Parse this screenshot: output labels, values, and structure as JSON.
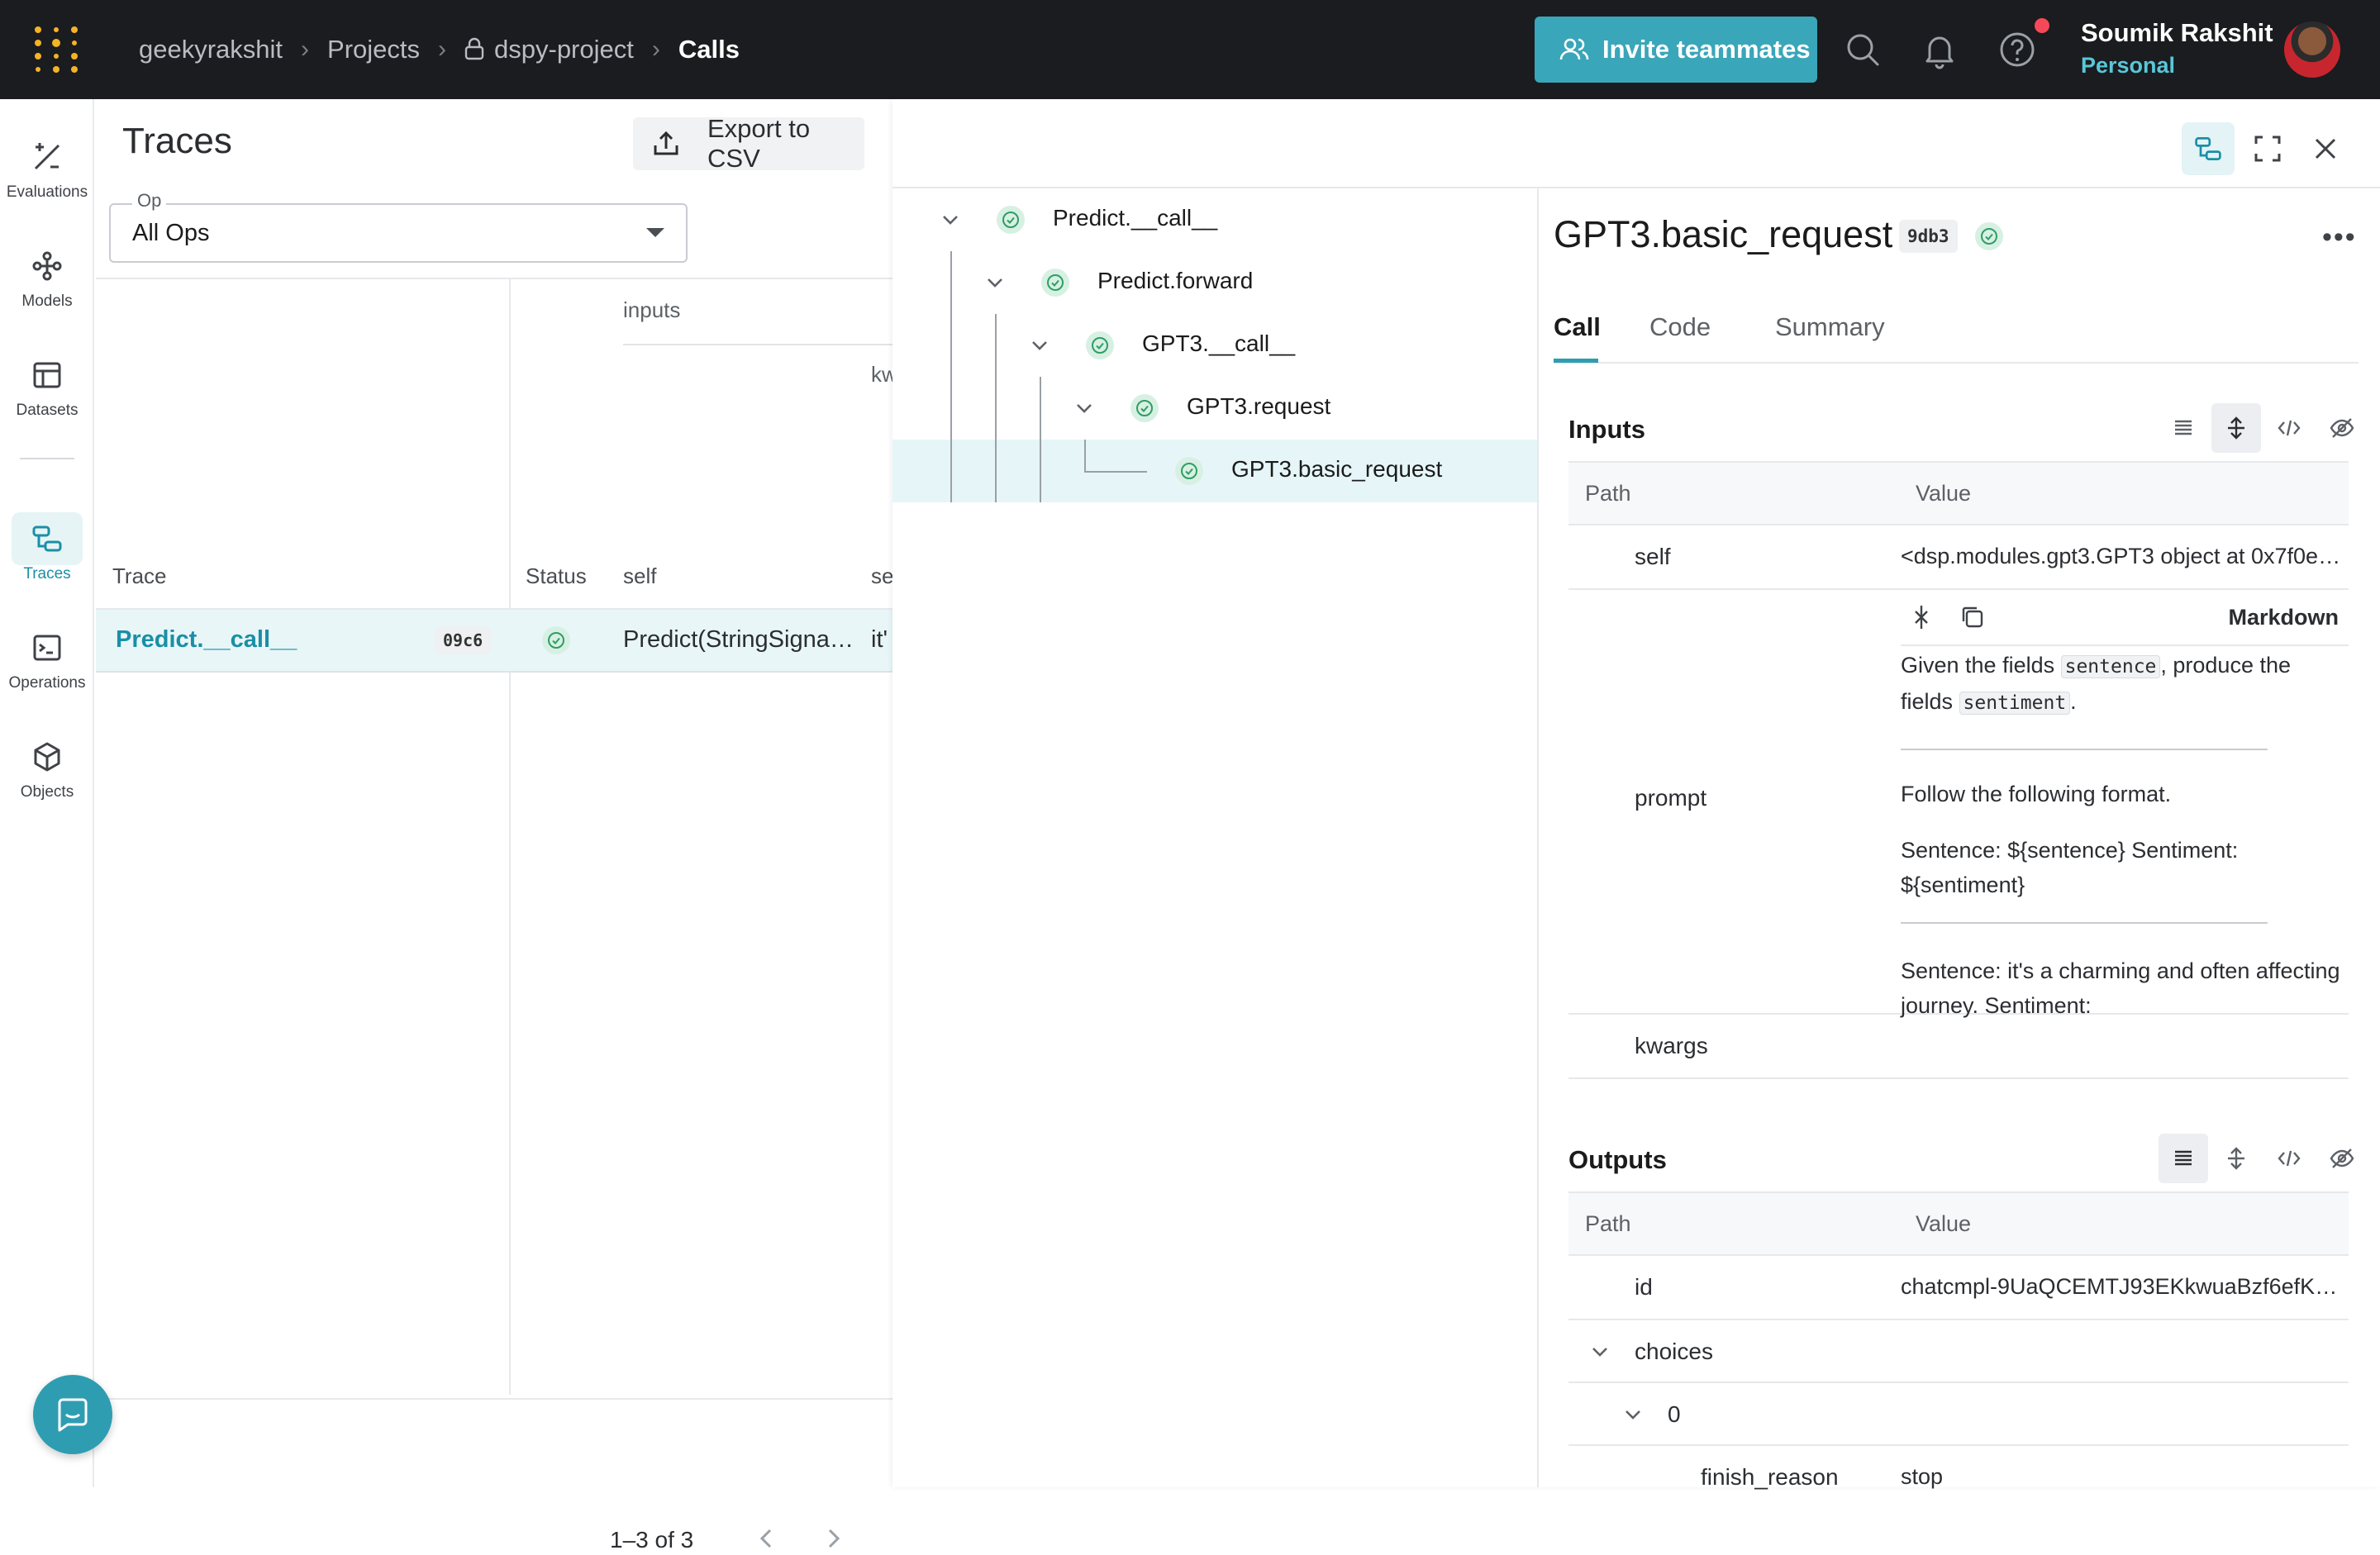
{
  "breadcrumb": {
    "entity": "geekyrakshit",
    "projects": "Projects",
    "project": "dspy-project",
    "page": "Calls"
  },
  "header": {
    "invite_label": "Invite teammates",
    "user_name": "Soumik Rakshit",
    "user_account": "Personal"
  },
  "sidebar": {
    "items": [
      {
        "label": "Evaluations",
        "icon": "evaluations-icon"
      },
      {
        "label": "Models",
        "icon": "models-icon"
      },
      {
        "label": "Datasets",
        "icon": "datasets-icon"
      },
      {
        "label": "Traces",
        "icon": "traces-icon"
      },
      {
        "label": "Operations",
        "icon": "operations-icon"
      },
      {
        "label": "Objects",
        "icon": "objects-icon"
      }
    ]
  },
  "traces": {
    "title": "Traces",
    "export_label": "Export to CSV",
    "op_label": "Op",
    "op_value": "All Ops",
    "group_inputs": "inputs",
    "group_kw": "kw",
    "columns": {
      "trace": "Trace",
      "status": "Status",
      "self": "self",
      "se": "se"
    },
    "rows": [
      {
        "name": "Predict.__call__",
        "id": "09c6",
        "self": "Predict(StringSigna…",
        "se": "it'"
      }
    ],
    "pagination": "1–3 of 3"
  },
  "tree": {
    "nodes": [
      {
        "label": "Predict.__call__"
      },
      {
        "label": "Predict.forward"
      },
      {
        "label": "GPT3.__call__"
      },
      {
        "label": "GPT3.request"
      },
      {
        "label": "GPT3.basic_request"
      }
    ]
  },
  "detail": {
    "title": "GPT3.basic_request",
    "id": "9db3",
    "more": "•••",
    "tabs": [
      "Call",
      "Code",
      "Summary"
    ],
    "inputs": {
      "title": "Inputs",
      "path_header": "Path",
      "value_header": "Value",
      "self_key": "self",
      "self_value": "<dsp.modules.gpt3.GPT3 object at 0x7f0e2…",
      "prompt_key": "prompt",
      "markdown_label": "Markdown",
      "prompt_line1_a": "Given the fields ",
      "prompt_code1": "sentence",
      "prompt_line1_b": ", produce the",
      "prompt_line2_a": "fields ",
      "prompt_code2": "sentiment",
      "prompt_line2_b": ".",
      "prompt_p2": "Follow the following format.",
      "prompt_p3": "Sentence: ${sentence} Sentiment: ${sentiment}",
      "prompt_p4": "Sentence: it's a charming and often affecting journey. Sentiment:",
      "kwargs_key": "kwargs"
    },
    "outputs": {
      "title": "Outputs",
      "path_header": "Path",
      "value_header": "Value",
      "id_key": "id",
      "id_value": "chatcmpl-9UaQCEMTJ93EKkwuaBzf6efKm…",
      "choices_key": "choices",
      "index_key": "0",
      "finish_key": "finish_reason",
      "finish_value": "stop"
    }
  },
  "colors": {
    "accent": "#2f9db1",
    "topbar": "#1a1c1f",
    "success": "#2e9e63"
  }
}
